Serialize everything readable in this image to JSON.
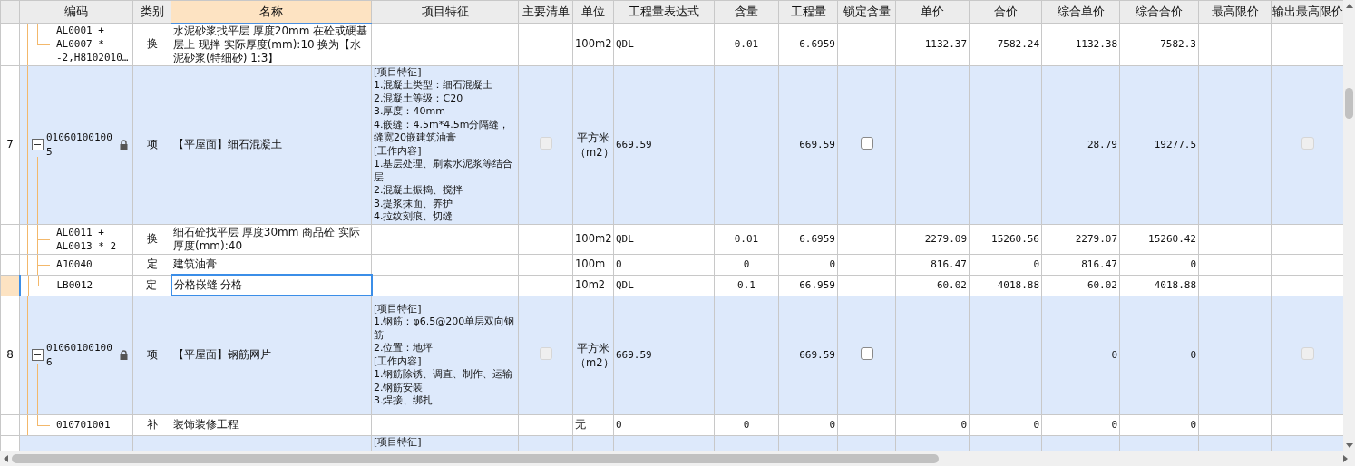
{
  "columns": [
    {
      "selected": false
    },
    {
      "label": "编码",
      "selected": false
    },
    {
      "label": "类别",
      "selected": false
    },
    {
      "label": "名称",
      "selected": true
    },
    {
      "label": "项目特征",
      "selected": false
    },
    {
      "label": "主要清单",
      "selected": false
    },
    {
      "label": "单位",
      "selected": false
    },
    {
      "label": "工程量表达式",
      "selected": false
    },
    {
      "label": "含量",
      "selected": false
    },
    {
      "label": "工程量",
      "selected": false
    },
    {
      "label": "锁定含量",
      "selected": false
    },
    {
      "label": "单价",
      "selected": false
    },
    {
      "label": "合价",
      "selected": false
    },
    {
      "label": "综合单价",
      "selected": false
    },
    {
      "label": "综合合价",
      "selected": false
    },
    {
      "label": "最高限价",
      "selected": false
    },
    {
      "label": "输出最高限价",
      "selected": false
    }
  ],
  "rows": [
    {
      "kind": "sub",
      "selected": false,
      "last": true,
      "code": "AL0001 + AL0007 * -2,H8102010…",
      "type": "换",
      "name": "水泥砂浆找平层 厚度20mm 在砼或硬基层上 现拌  实际厚度(mm):10  换为【水泥砂浆(特细砂) 1:3】",
      "unit": "100m2",
      "expr": "QDL",
      "content": "0.01",
      "qty": "6.6959",
      "unit_price": "1132.37",
      "total": "7582.24",
      "comp_unit_price": "1132.38",
      "comp_total": "7582.3"
    },
    {
      "kind": "item",
      "selected": false,
      "number": "7",
      "expanded": true,
      "locked": true,
      "code": "010601001005",
      "type": "项",
      "name": "【平屋面】细石混凝土",
      "feature": "[项目特征]\n1.混凝土类型：细石混凝土\n2.混凝土等级：C20\n3.厚度：40mm\n4.嵌缝：4.5m*4.5m分隔缝，缝宽20嵌建筑油膏\n[工作内容]\n1.基层处理、刷素水泥浆等结合层\n2.混凝土振捣、搅拌\n3.提浆抹面、养护\n4.拉纹刻痕、切缝",
      "main_list": {
        "checked": false,
        "disabled": true
      },
      "unit": "平方米（m2）",
      "expr": "669.59",
      "qty": "669.59",
      "lock_content": {
        "checked": false,
        "disabled": false
      },
      "comp_unit_price": "28.79",
      "comp_total": "19277.5",
      "output_max": {
        "checked": false,
        "disabled": true
      }
    },
    {
      "kind": "sub",
      "selected": false,
      "last": false,
      "code": "AL0011 + AL0013 * 2",
      "type": "换",
      "name": "细石砼找平层 厚度30mm 商品砼  实际厚度(mm):40",
      "unit": "100m2",
      "expr": "QDL",
      "content": "0.01",
      "qty": "6.6959",
      "unit_price": "2279.09",
      "total": "15260.56",
      "comp_unit_price": "2279.07",
      "comp_total": "15260.42"
    },
    {
      "kind": "sub",
      "selected": false,
      "last": false,
      "code": "AJ0040",
      "type": "定",
      "name": "建筑油膏",
      "unit": "100m",
      "expr": "0",
      "content": "0",
      "qty": "0",
      "unit_price": "816.47",
      "total": "0",
      "comp_unit_price": "816.47",
      "comp_total": "0"
    },
    {
      "kind": "sub",
      "selected": true,
      "last": true,
      "code": "LB0012",
      "type": "定",
      "name": "分格嵌缝 分格",
      "unit": "10m2",
      "expr": "QDL",
      "content": "0.1",
      "qty": "66.959",
      "unit_price": "60.02",
      "total": "4018.88",
      "comp_unit_price": "60.02",
      "comp_total": "4018.88"
    },
    {
      "kind": "item",
      "selected": false,
      "number": "8",
      "expanded": true,
      "locked": true,
      "code": "010601001006",
      "type": "项",
      "name": "【平屋面】钢筋网片",
      "feature": "[项目特征]\n1.钢筋：φ6.5@200单层双向钢筋\n2.位置：地坪\n[工作内容]\n1.钢筋除锈、调直、制作、运输\n2.钢筋安装\n3.焊接、绑扎",
      "main_list": {
        "checked": false,
        "disabled": true
      },
      "unit": "平方米（m2）",
      "expr": "669.59",
      "qty": "669.59",
      "lock_content": {
        "checked": false,
        "disabled": false
      },
      "comp_unit_price": "0",
      "comp_total": "0",
      "output_max": {
        "checked": false,
        "disabled": true
      }
    },
    {
      "kind": "sub",
      "selected": false,
      "last": true,
      "code": "010701001",
      "type": "补",
      "name": "装饰装修工程",
      "unit": "无",
      "expr": "0",
      "content": "0",
      "qty": "0",
      "unit_price": "0",
      "total": "0",
      "comp_unit_price": "0",
      "comp_total": "0"
    },
    {
      "kind": "partial",
      "selected": false,
      "feature": "[项目特征]"
    }
  ]
}
